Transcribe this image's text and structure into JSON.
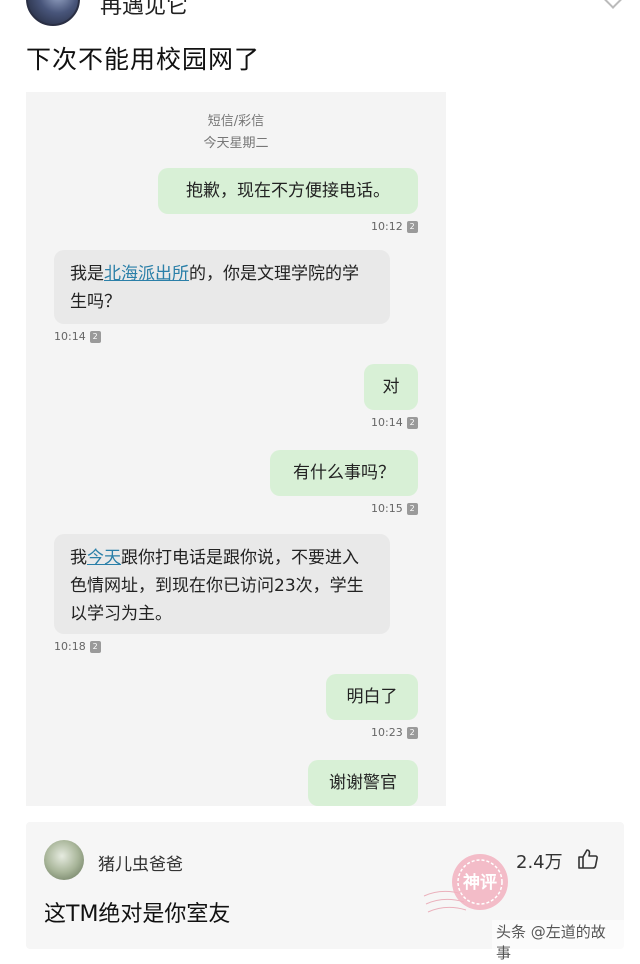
{
  "header": {
    "username": "再遇见它"
  },
  "post": {
    "text": "下次不能用校园网了"
  },
  "sms": {
    "type_label": "短信/彩信",
    "day_label": "今天星期二",
    "sim_badge": "2",
    "messages": [
      {
        "dir": "sent",
        "text": "抱歉，现在不方便接电话。",
        "time": "10:12"
      },
      {
        "dir": "recv",
        "pre": "我是",
        "link": "北海派出所",
        "post": "的，你是文理学院的学生吗？",
        "time": "10:14"
      },
      {
        "dir": "sent",
        "text": "对",
        "time": "10:14"
      },
      {
        "dir": "sent",
        "text": "有什么事吗？",
        "time": "10:15"
      },
      {
        "dir": "recv",
        "pre": "我",
        "link": "今天",
        "post": "跟你打电话是跟你说，不要进入色情网址，到现在你已访问23次，学生以学习为主。",
        "time": "10:18"
      },
      {
        "dir": "sent",
        "text": "明白了",
        "time": "10:23"
      },
      {
        "dir": "sent",
        "text": "谢谢警官"
      }
    ]
  },
  "comment": {
    "username": "猪儿虫爸爸",
    "likes": "2.4万",
    "text": "这TM绝对是你室友",
    "stamp_text": "神评"
  },
  "watermark": "头条 @左道的故事",
  "colors": {
    "sent_bubble": "#d8f0d6",
    "recv_bubble": "#e9e9e9",
    "link": "#2a7fa8",
    "stamp": "#e8a0ae"
  },
  "icons": [
    "chevron-down-icon",
    "sim-2-icon",
    "thumbs-up-icon"
  ]
}
